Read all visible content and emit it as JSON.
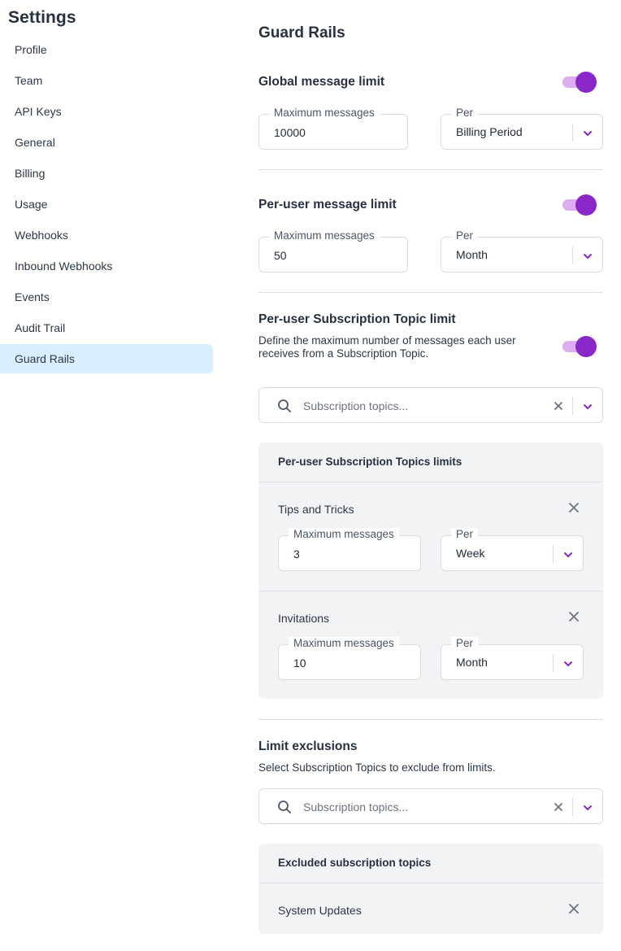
{
  "sidebar": {
    "title": "Settings",
    "items": [
      {
        "label": "Profile"
      },
      {
        "label": "Team"
      },
      {
        "label": "API Keys"
      },
      {
        "label": "General"
      },
      {
        "label": "Billing"
      },
      {
        "label": "Usage"
      },
      {
        "label": "Webhooks"
      },
      {
        "label": "Inbound Webhooks"
      },
      {
        "label": "Events"
      },
      {
        "label": "Audit Trail"
      },
      {
        "label": "Guard Rails",
        "active": true
      }
    ]
  },
  "main": {
    "title": "Guard Rails",
    "global": {
      "title": "Global message limit",
      "enabled": true,
      "max_label": "Maximum messages",
      "max_value": "10000",
      "per_label": "Per",
      "per_value": "Billing Period"
    },
    "per_user": {
      "title": "Per-user message limit",
      "enabled": true,
      "max_label": "Maximum messages",
      "max_value": "50",
      "per_label": "Per",
      "per_value": "Month"
    },
    "topic_limit": {
      "title": "Per-user Subscription Topic limit",
      "description": "Define the maximum number of messages each user receives from a Subscription Topic.",
      "enabled": true,
      "search_placeholder": "Subscription topics...",
      "panel_title": "Per-user Subscription Topics limits",
      "topics": [
        {
          "name": "Tips and Tricks",
          "max_label": "Maximum messages",
          "max_value": "3",
          "per_label": "Per",
          "per_value": "Week"
        },
        {
          "name": "Invitations",
          "max_label": "Maximum messages",
          "max_value": "10",
          "per_label": "Per",
          "per_value": "Month"
        }
      ]
    },
    "exclusions": {
      "title": "Limit exclusions",
      "description": "Select Subscription Topics to exclude from limits.",
      "search_placeholder": "Subscription topics...",
      "panel_title": "Excluded subscription topics",
      "topics": [
        {
          "name": "System Updates"
        }
      ]
    }
  },
  "colors": {
    "accent": "#8a27c8",
    "toggle_track": "#dcaef0",
    "active_nav": "#d9efff",
    "panel_bg": "#f2f3f5"
  },
  "icons": [
    "search-icon",
    "clear-icon",
    "chevron-down-icon",
    "close-icon"
  ]
}
